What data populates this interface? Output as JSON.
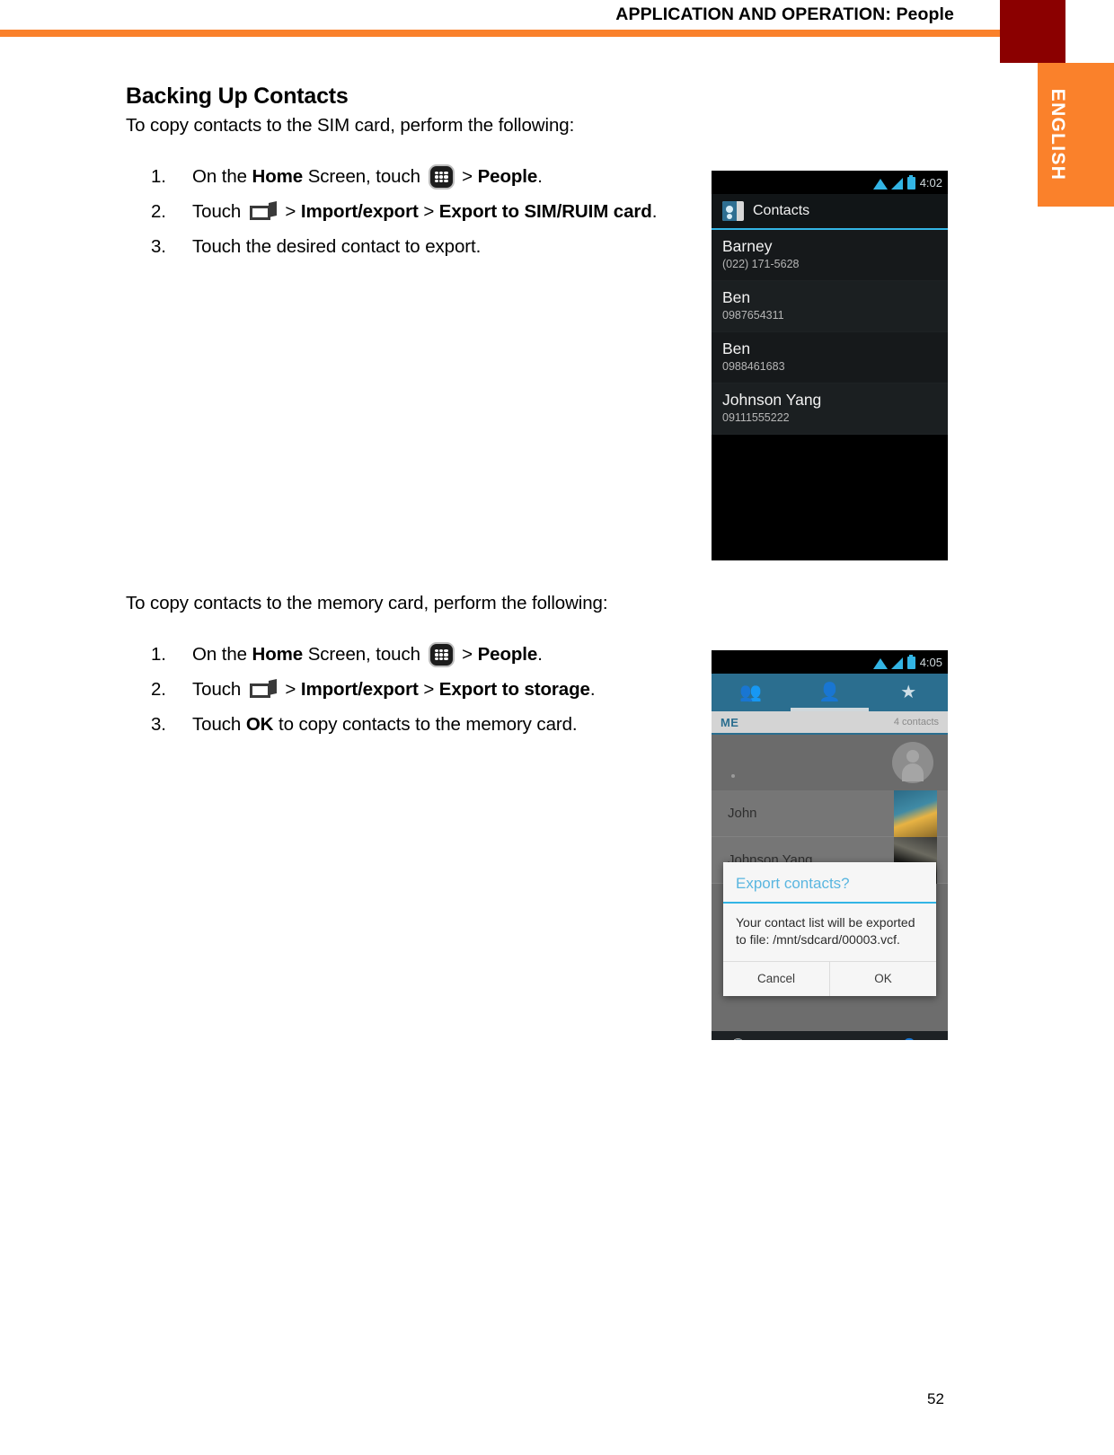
{
  "header": {
    "title": "APPLICATION AND OPERATION: People",
    "accent_color": "#FA812B",
    "corner_color": "#8B0000"
  },
  "language_tab": {
    "label": "ENGLISH"
  },
  "section": {
    "title": "Backing Up Contacts"
  },
  "sim_section": {
    "intro": "To copy contacts to the SIM card, perform the following:",
    "steps": [
      {
        "num": "1.",
        "pre": "On the ",
        "bold1": "Home",
        "mid": " Screen, touch ",
        "icon": "apps-grid-icon",
        "sep": " > ",
        "bold2": "People",
        "post": "."
      },
      {
        "num": "2.",
        "pre": "Touch ",
        "icon": "recent-apps-icon",
        "sep1": " > ",
        "bold1": "Import/export",
        "sep2": " > ",
        "bold2": "Export to SIM/RUIM card",
        "post": "."
      },
      {
        "num": "3.",
        "text": "Touch the desired contact to export."
      }
    ]
  },
  "storage_section": {
    "intro": "To copy contacts to the memory card, perform the following:",
    "steps": [
      {
        "num": "1.",
        "pre": "On the ",
        "bold1": "Home",
        "mid": " Screen, touch ",
        "icon": "apps-grid-icon",
        "sep": " > ",
        "bold2": "People",
        "post": "."
      },
      {
        "num": "2.",
        "pre": "Touch ",
        "icon": "recent-apps-icon",
        "sep1": " > ",
        "bold1": "Import/export",
        "sep2": " > ",
        "bold2": "Export to storage",
        "post": "."
      },
      {
        "num": "3.",
        "pre": "Touch ",
        "bold1": "OK",
        "post": " to copy contacts to the memory card."
      }
    ]
  },
  "phone_contacts": {
    "status_time": "4:02",
    "app_title": "Contacts",
    "contacts": [
      {
        "name": "Barney",
        "phone": "(022) 171-5628"
      },
      {
        "name": "Ben",
        "phone": "0987654311"
      },
      {
        "name": "Ben",
        "phone": "0988461683"
      },
      {
        "name": "Johnson Yang",
        "phone": "09111555222"
      }
    ]
  },
  "phone_export": {
    "status_time": "4:05",
    "tabs": [
      "groups-icon",
      "person-icon",
      "star-icon"
    ],
    "me_label": "ME",
    "contact_count": "4 contacts",
    "dialog": {
      "title": "Export contacts?",
      "message": "Your contact list will be exported to file: /mnt/sdcard/00003.vcf.",
      "cancel_label": "Cancel",
      "ok_label": "OK"
    },
    "list": [
      {
        "name": "John"
      },
      {
        "name": "Johnson Yang"
      }
    ],
    "bottom_bar": [
      "search-icon",
      "add-contact-icon"
    ]
  },
  "footer": {
    "page_number": "52"
  }
}
